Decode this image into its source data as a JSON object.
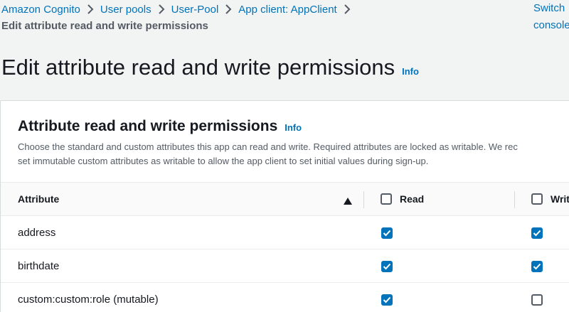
{
  "breadcrumb": {
    "items": [
      "Amazon Cognito",
      "User pools",
      "User-Pool",
      "App client: AppClient"
    ],
    "current": "Edit attribute read and write permissions"
  },
  "switch_link": {
    "line1": "Switch",
    "line2": "console"
  },
  "page": {
    "title": "Edit attribute read and write permissions",
    "info": "Info"
  },
  "panel": {
    "title": "Attribute read and write permissions",
    "info": "Info",
    "description_line1": "Choose the standard and custom attributes this app can read and write. Required attributes are locked as writable. We rec",
    "description_line2": "set immutable custom attributes as writable to allow the app client to set initial values during sign-up."
  },
  "table": {
    "columns": {
      "attribute": "Attribute",
      "read": "Read",
      "write": "Writ"
    },
    "sort_icon": "caret-up-icon",
    "header_read_checked": false,
    "header_write_checked": false,
    "rows": [
      {
        "attribute": "address",
        "read": true,
        "write": true
      },
      {
        "attribute": "birthdate",
        "read": true,
        "write": true
      },
      {
        "attribute": "custom:custom:role (mutable)",
        "read": true,
        "write": false
      }
    ]
  },
  "colors": {
    "link": "#0073bb",
    "checkbox_checked": "#0073bb",
    "background": "#f2f3f3",
    "card": "#ffffff"
  }
}
